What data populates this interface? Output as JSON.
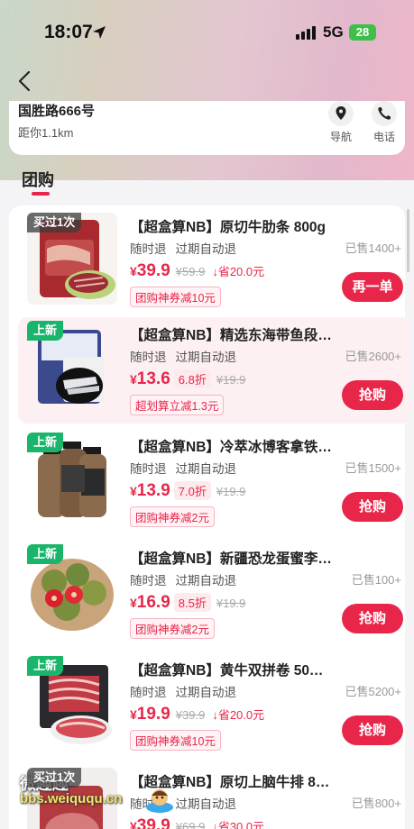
{
  "status_bar": {
    "time": "18:07",
    "network": "5G",
    "battery": "28"
  },
  "store": {
    "address": "国胜路666号",
    "distance": "距你1.1km",
    "navigate_label": "导航",
    "phone_label": "电话"
  },
  "section": {
    "title": "团购"
  },
  "items": [
    {
      "badge": "买过1次",
      "badge_style": "gray",
      "title": "【超盒算NB】原切牛肋条 800g",
      "tag1": "随时退",
      "tag2": "过期自动退",
      "sold": "已售1400+",
      "price": "39.9",
      "orig_price": "¥59.9",
      "discount": "",
      "save": "省20.0元",
      "promo": "团购神券减10元",
      "button": "再一单",
      "highlight": false
    },
    {
      "badge": "上新",
      "badge_style": "green",
      "title": "【超盒算NB】精选东海带鱼段…",
      "tag1": "随时退",
      "tag2": "过期自动退",
      "sold": "已售2600+",
      "price": "13.6",
      "orig_price": "¥19.9",
      "discount": "6.8折",
      "save": "",
      "promo": "超划算立减1.3元",
      "button": "抢购",
      "highlight": true
    },
    {
      "badge": "上新",
      "badge_style": "green",
      "title": "【超盒算NB】冷萃冰博客拿铁…",
      "tag1": "随时退",
      "tag2": "过期自动退",
      "sold": "已售1500+",
      "price": "13.9",
      "orig_price": "¥19.9",
      "discount": "7.0折",
      "save": "",
      "promo": "团购神券减2元",
      "button": "抢购",
      "highlight": false
    },
    {
      "badge": "上新",
      "badge_style": "green",
      "title": "【超盒算NB】新疆恐龙蛋蜜李…",
      "tag1": "随时退",
      "tag2": "过期自动退",
      "sold": "已售100+",
      "price": "16.9",
      "orig_price": "¥19.9",
      "discount": "8.5折",
      "save": "",
      "promo": "团购神券减2元",
      "button": "抢购",
      "highlight": false
    },
    {
      "badge": "上新",
      "badge_style": "green",
      "title": "【超盒算NB】黄牛双拼卷 50…",
      "tag1": "随时退",
      "tag2": "过期自动退",
      "sold": "已售5200+",
      "price": "19.9",
      "orig_price": "¥39.9",
      "discount": "",
      "save": "省20.0元",
      "promo": "团购神券减10元",
      "button": "抢购",
      "highlight": false
    },
    {
      "badge": "买过1次",
      "badge_style": "gray",
      "title": "【超盒算NB】原切上脑牛排 8…",
      "tag1": "随时退",
      "tag2": "过期自动退",
      "sold": "已售800+",
      "price": "39.9",
      "orig_price": "¥69.9",
      "discount": "",
      "save": "省30.0元",
      "promo": "",
      "button": "",
      "highlight": false
    }
  ],
  "watermark": {
    "line1": "微趣趣",
    "line2": "bbs.weiququ.cn"
  },
  "colors": {
    "accent": "#e8264a",
    "badge_green": "#1ab56b"
  }
}
